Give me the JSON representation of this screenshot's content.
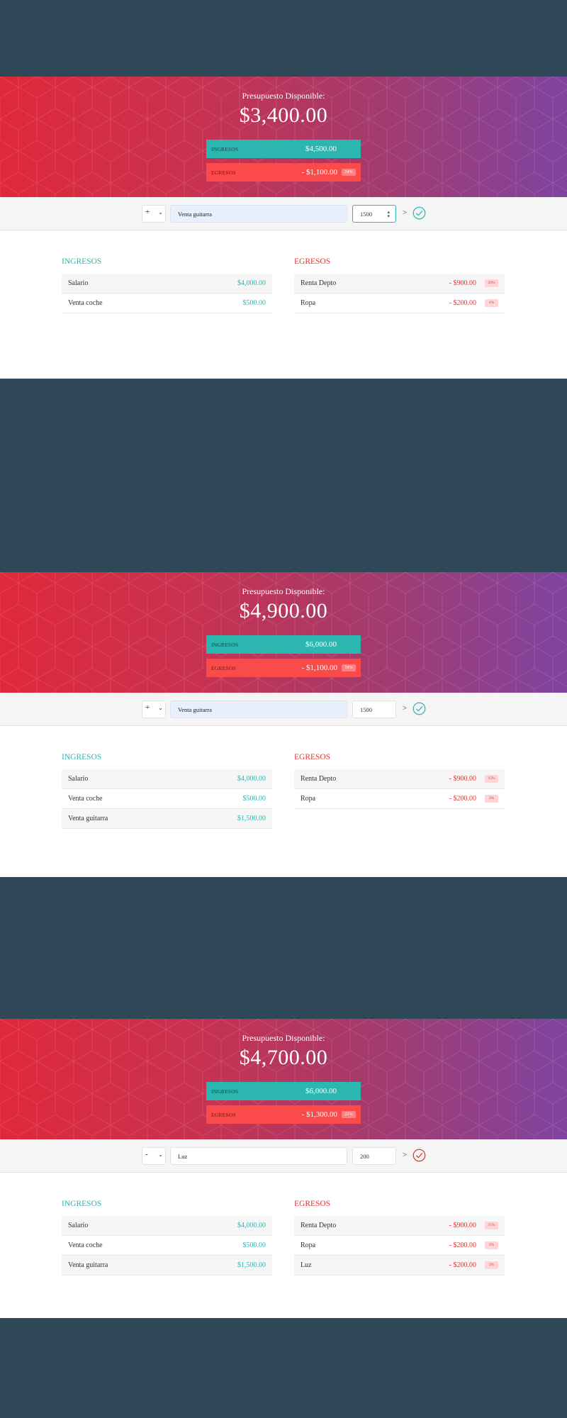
{
  "screens": [
    {
      "hero": {
        "title": "Presupuesto Disponible:",
        "value": "$3,400.00",
        "income_label": "Ingresos",
        "income_value": "$4,500.00",
        "expense_label": "Egresos",
        "expense_value": "- $1,100.00",
        "expense_pct": "24%"
      },
      "form": {
        "type": "+",
        "description": "Venta guitarra",
        "amount": "1500",
        "submit_arrow": ">"
      },
      "lists": {
        "income_title": "Ingresos",
        "expense_title": "Egresos",
        "income": [
          {
            "name": "Salario",
            "value": "$4,000.00"
          },
          {
            "name": "Venta coche",
            "value": "$500.00"
          }
        ],
        "expenses": [
          {
            "name": "Renta Depto",
            "value": "- $900.00",
            "pct": "20%"
          },
          {
            "name": "Ropa",
            "value": "- $200.00",
            "pct": "4%"
          }
        ]
      }
    },
    {
      "hero": {
        "title": "Presupuesto Disponible:",
        "value": "$4,900.00",
        "income_label": "Ingresos",
        "income_value": "$6,000.00",
        "expense_label": "Egresos",
        "expense_value": "- $1,100.00",
        "expense_pct": "18%"
      },
      "form": {
        "type": "+",
        "description": "Venta guitarra",
        "amount": "1500",
        "submit_arrow": ">"
      },
      "lists": {
        "income_title": "Ingresos",
        "expense_title": "Egresos",
        "income": [
          {
            "name": "Salario",
            "value": "$4,000.00"
          },
          {
            "name": "Venta coche",
            "value": "$500.00"
          },
          {
            "name": "Venta guitarra",
            "value": "$1,500.00"
          }
        ],
        "expenses": [
          {
            "name": "Renta Depto",
            "value": "- $900.00",
            "pct": "15%"
          },
          {
            "name": "Ropa",
            "value": "- $200.00",
            "pct": "3%"
          }
        ]
      }
    },
    {
      "hero": {
        "title": "Presupuesto Disponible:",
        "value": "$4,700.00",
        "income_label": "Ingresos",
        "income_value": "$6,000.00",
        "expense_label": "Egresos",
        "expense_value": "- $1,300.00",
        "expense_pct": "22%"
      },
      "form": {
        "type": "-",
        "description": "Luz",
        "amount": "200",
        "submit_arrow": ">"
      },
      "lists": {
        "income_title": "Ingresos",
        "expense_title": "Egresos",
        "income": [
          {
            "name": "Salario",
            "value": "$4,000.00"
          },
          {
            "name": "Venta coche",
            "value": "$500.00"
          },
          {
            "name": "Venta guitarra",
            "value": "$1,500.00"
          }
        ],
        "expenses": [
          {
            "name": "Renta Depto",
            "value": "- $900.00",
            "pct": "15%"
          },
          {
            "name": "Ropa",
            "value": "- $200.00",
            "pct": "3%"
          },
          {
            "name": "Luz",
            "value": "- $200.00",
            "pct": "3%"
          }
        ]
      }
    }
  ],
  "colors": {
    "background": "#2f4858",
    "income": "#2bb7b0",
    "expense": "#e03434",
    "gradient_start": "#e0283a",
    "gradient_end": "#7f44a0"
  },
  "icons": {
    "check": "check-circle-icon",
    "dropdown": "chevron-down-icon",
    "spinner": "spinner-arrows-icon"
  }
}
